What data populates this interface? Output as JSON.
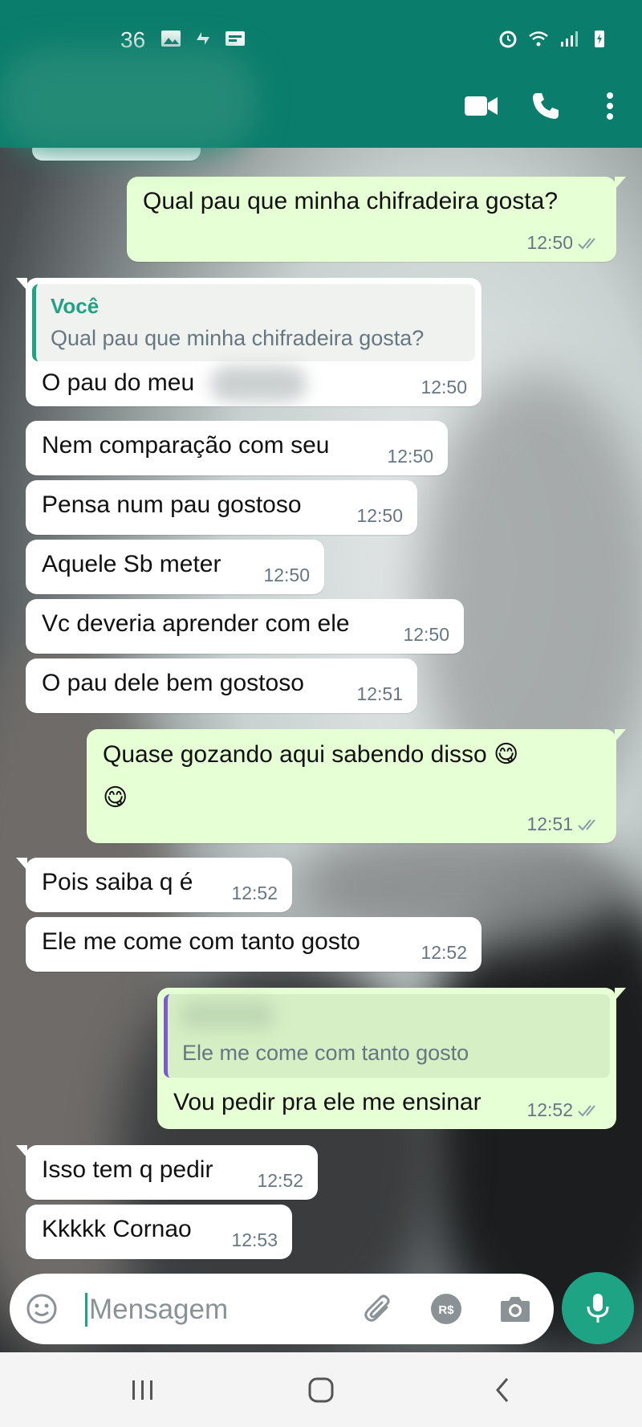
{
  "status_bar": {
    "time": "36"
  },
  "messages": [
    {
      "dir": "out",
      "text": "Qual pau que minha chifradeira gosta?",
      "time": "12:50",
      "ticks": true
    },
    {
      "dir": "in",
      "quote_author": "Você",
      "quote_text": "Qual pau que minha chifradeira gosta?",
      "text": "O pau do meu",
      "time": "12:50"
    },
    {
      "dir": "in",
      "text": "Nem comparação com seu",
      "time": "12:50"
    },
    {
      "dir": "in",
      "text": "Pensa num pau gostoso",
      "time": "12:50"
    },
    {
      "dir": "in",
      "text": "Aquele Sb meter",
      "time": "12:50"
    },
    {
      "dir": "in",
      "text": "Vc deveria aprender com ele",
      "time": "12:50"
    },
    {
      "dir": "in",
      "text": "O pau dele bem gostoso",
      "time": "12:51"
    },
    {
      "dir": "out",
      "text_line1": "Quase gozando aqui sabendo disso 😋",
      "text_line2": "😋",
      "time": "12:51",
      "ticks": true
    },
    {
      "dir": "in",
      "text": "Pois saiba q é",
      "time": "12:52"
    },
    {
      "dir": "in",
      "text": "Ele me come com tanto gosto",
      "time": "12:52"
    },
    {
      "dir": "out",
      "quote_text": "Ele me come com tanto gosto",
      "text": "Vou pedir pra ele me ensinar",
      "time": "12:52",
      "ticks": true
    },
    {
      "dir": "in",
      "text": "Isso tem q pedir",
      "time": "12:52"
    },
    {
      "dir": "in",
      "text": "Kkkkk Cornao",
      "time": "12:53"
    }
  ],
  "composer": {
    "placeholder": "Mensagem"
  },
  "colors": {
    "header": "#0b7d6c",
    "accent": "#1fa385",
    "outgoing": "#e6ffd4",
    "incoming": "#ffffff"
  },
  "icons": [
    "video-call-icon",
    "phone-icon",
    "more-options-icon",
    "emoji-icon",
    "attach-icon",
    "payment-icon",
    "camera-icon",
    "mic-icon",
    "recent-apps-icon",
    "home-icon",
    "back-icon"
  ]
}
